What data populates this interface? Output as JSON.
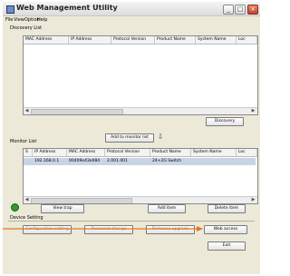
{
  "window": {
    "title": "Web Management Utility"
  },
  "menu": [
    "File",
    "View",
    "Option",
    "Help"
  ],
  "discovery": {
    "group_label": "Discovery List",
    "columns": [
      "MAC Address",
      "IP Address",
      "Protocol Version",
      "Product Name",
      "System Name",
      "Loc"
    ],
    "discovery_button": "Discovery"
  },
  "add_to_monitor_button": "Add to monitor list",
  "monitor": {
    "group_label": "Monitor List",
    "columns": [
      "S",
      "IP Address",
      "MAC Address",
      "Protocol Version",
      "Product Name",
      "System Name",
      "Loc"
    ],
    "rows": [
      {
        "ip": "192.168.0.1",
        "mac": "00409e43e084",
        "protocol": "2.001.001",
        "product": "24+2G Switch"
      }
    ],
    "view_trap": "View trap",
    "add_item": "Add item",
    "delete_item": "Delete item"
  },
  "device_setting": {
    "group_label": "Device Setting",
    "configuration_setting": "Configuration setting",
    "password_change": "Password change",
    "firmware_upgrade": "Firmware upgrade",
    "web_access": "Web access"
  },
  "exit_button": "Exit",
  "colors": {
    "status_ok": "#2e9a2e",
    "annotation_arrow": "#e8731c"
  }
}
